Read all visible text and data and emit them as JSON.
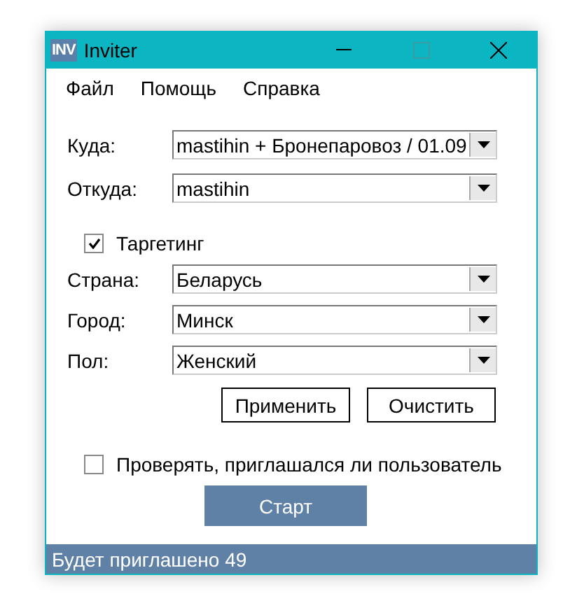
{
  "window": {
    "title": "Inviter",
    "logo": "INV"
  },
  "menu": [
    "Файл",
    "Помощь",
    "Справка"
  ],
  "fields": [
    {
      "label": "Куда:",
      "value": "mastihin + Бронепаровоз / 01.09"
    },
    {
      "label": "Откуда:",
      "value": "mastihin"
    }
  ],
  "targeting": {
    "label": "Таргетинг",
    "checked": true
  },
  "filters": [
    {
      "label": "Страна:",
      "value": "Беларусь"
    },
    {
      "label": "Город:",
      "value": "Минск"
    },
    {
      "label": "Пол:",
      "value": "Женский"
    }
  ],
  "buttons": [
    "Применить",
    "Очистить"
  ],
  "check_invited": {
    "label": "Проверять, приглашался ли пользователь",
    "checked": false
  },
  "start_button": "Старт",
  "status_bar": "Будет приглашено 49"
}
